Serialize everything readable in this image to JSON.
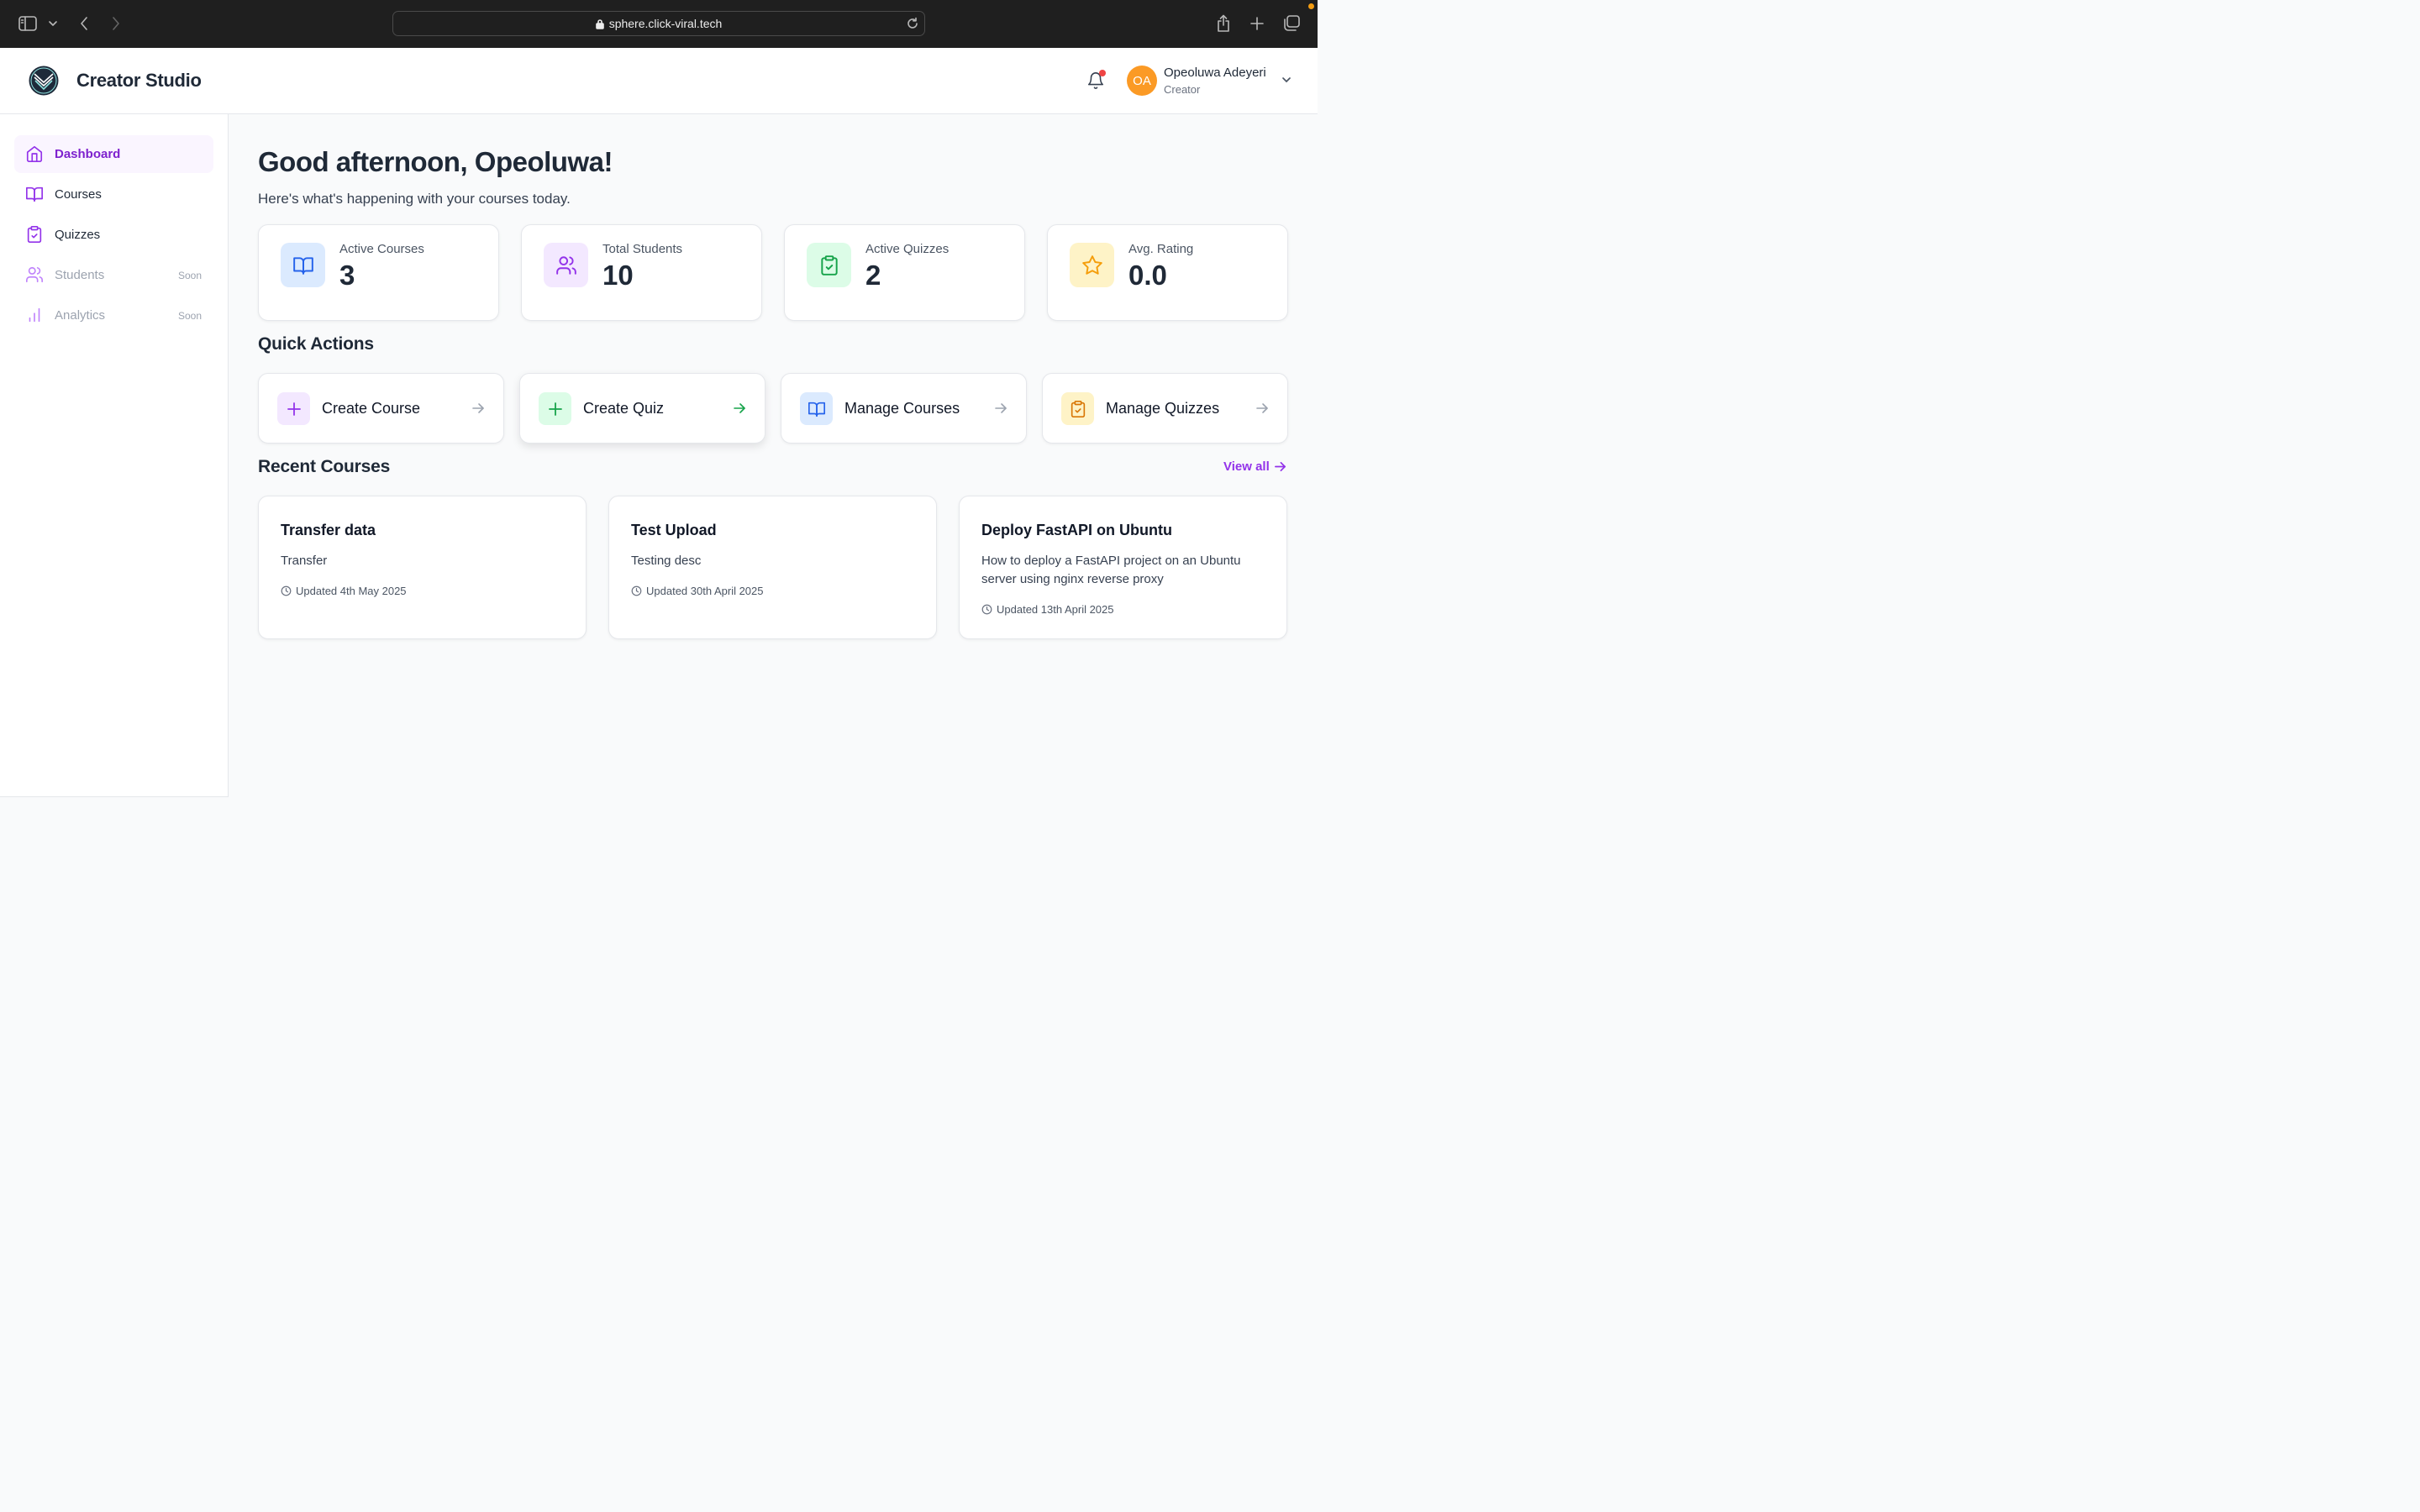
{
  "browser": {
    "url": "sphere.click-viral.tech"
  },
  "header": {
    "brand": "Creator Studio",
    "user": {
      "initials": "OA",
      "name": "Opeoluwa Adeyeri",
      "role": "Creator"
    }
  },
  "sidebar": {
    "items": [
      {
        "label": "Dashboard",
        "icon": "home-icon",
        "active": true
      },
      {
        "label": "Courses",
        "icon": "book-icon"
      },
      {
        "label": "Quizzes",
        "icon": "clipboard-check-icon"
      },
      {
        "label": "Students",
        "icon": "users-icon",
        "badge": "Soon"
      },
      {
        "label": "Analytics",
        "icon": "bar-chart-icon",
        "badge": "Soon"
      }
    ]
  },
  "main": {
    "greeting": "Good afternoon, Opeoluwa!",
    "subtitle": "Here's what's happening with your courses today.",
    "stats": [
      {
        "label": "Active Courses",
        "value": "3",
        "icon": "book-icon",
        "color": "#2563eb",
        "bg": "#dbeafe"
      },
      {
        "label": "Total Students",
        "value": "10",
        "icon": "users-icon",
        "color": "#9333ea",
        "bg": "#f3e8ff"
      },
      {
        "label": "Active Quizzes",
        "value": "2",
        "icon": "clipboard-check-icon",
        "color": "#16a34a",
        "bg": "#dcfce7"
      },
      {
        "label": "Avg. Rating",
        "value": "0.0",
        "icon": "star-icon",
        "color": "#f59e0b",
        "bg": "#fef3c7"
      }
    ],
    "quick_actions_title": "Quick Actions",
    "quick_actions": [
      {
        "label": "Create Course",
        "icon": "plus-icon",
        "color": "#9333ea",
        "bg": "#f3e8ff"
      },
      {
        "label": "Create Quiz",
        "icon": "plus-icon",
        "color": "#16a34a",
        "bg": "#dcfce7"
      },
      {
        "label": "Manage Courses",
        "icon": "book-icon",
        "color": "#2563eb",
        "bg": "#dbeafe"
      },
      {
        "label": "Manage Quizzes",
        "icon": "clipboard-icon",
        "color": "#d97706",
        "bg": "#fef3c7"
      }
    ],
    "recent_title": "Recent Courses",
    "view_all": "View all",
    "recent_courses": [
      {
        "title": "Transfer data",
        "desc": "Transfer",
        "updated": "Updated 4th May 2025"
      },
      {
        "title": "Test Upload",
        "desc": "Testing desc",
        "updated": "Updated 30th April 2025"
      },
      {
        "title": "Deploy FastAPI on Ubuntu",
        "desc": "How to deploy a FastAPI project on an Ubuntu server using nginx reverse proxy",
        "updated": "Updated 13th April 2025"
      }
    ]
  },
  "colors": {
    "accent": "#9333ea",
    "notification": "#ef4444",
    "avatar": "#fb9a25"
  }
}
